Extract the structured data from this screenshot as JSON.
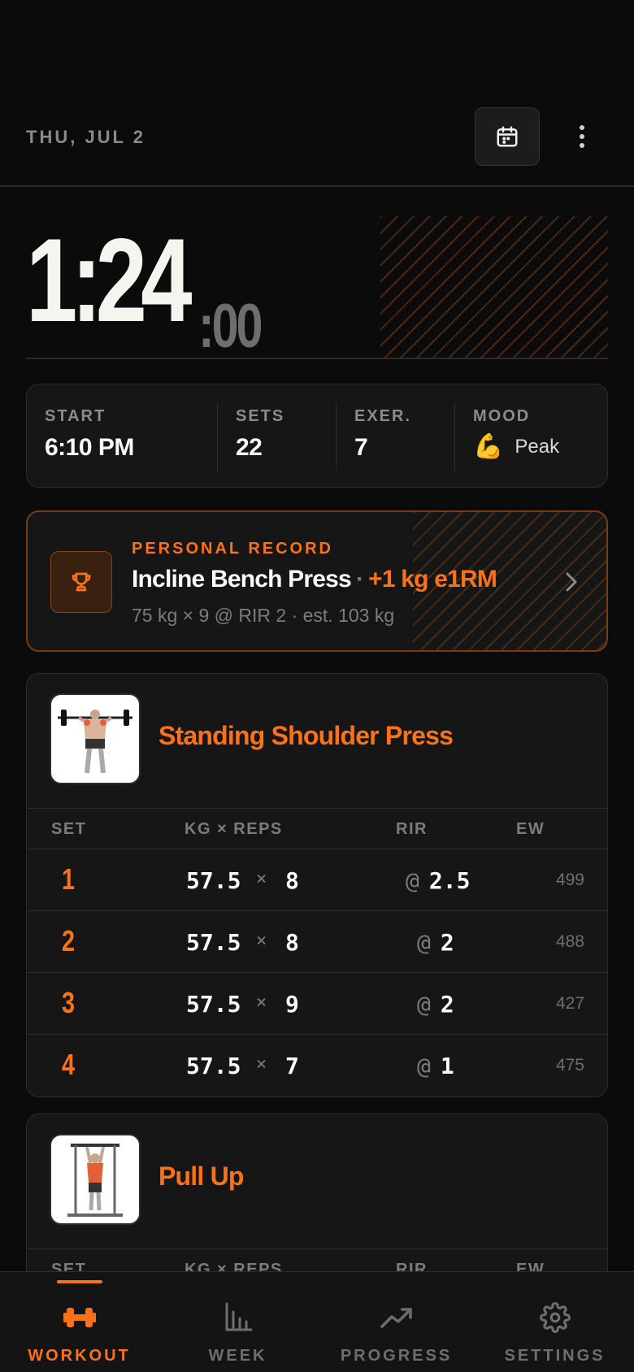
{
  "header": {
    "date": "THU, JUL 2"
  },
  "timer": {
    "main": "1:24",
    "seconds": ":00"
  },
  "stats": [
    {
      "label": "START",
      "value": "6:10 PM"
    },
    {
      "label": "SETS",
      "value": "22"
    },
    {
      "label": "EXER.",
      "value": "7"
    },
    {
      "label": "MOOD",
      "emoji": "💪",
      "value": "Peak"
    }
  ],
  "record": {
    "label": "PERSONAL RECORD",
    "exercise": "Incline Bench Press",
    "separator": "·",
    "gain": "+1 kg e1RM",
    "detail": "75 kg × 9 @ RIR 2  ·  est. 103 kg"
  },
  "table_headers": {
    "set": "SET",
    "kg_reps": "KG × REPS",
    "rir": "RIR",
    "ew": "EW"
  },
  "exercises": [
    {
      "name": "Standing Shoulder Press",
      "sets": [
        {
          "num": "1",
          "kg": "57.5",
          "x": "×",
          "reps": "8",
          "at": "@",
          "rir": "2.5",
          "ew": "499"
        },
        {
          "num": "2",
          "kg": "57.5",
          "x": "×",
          "reps": "8",
          "at": "@",
          "rir": "2",
          "ew": "488"
        },
        {
          "num": "3",
          "kg": "57.5",
          "x": "×",
          "reps": "9",
          "at": "@",
          "rir": "2",
          "ew": "427"
        },
        {
          "num": "4",
          "kg": "57.5",
          "x": "×",
          "reps": "7",
          "at": "@",
          "rir": "1",
          "ew": "475"
        }
      ]
    },
    {
      "name": "Pull Up"
    }
  ],
  "nav": [
    {
      "label": "WORKOUT",
      "icon": "dumbbell-icon"
    },
    {
      "label": "WEEK",
      "icon": "bar-chart-icon"
    },
    {
      "label": "PROGRESS",
      "icon": "trend-up-icon"
    },
    {
      "label": "SETTINGS",
      "icon": "gear-icon"
    }
  ],
  "colors": {
    "accent": "#f97316",
    "background": "#0b0b0b",
    "card": "#161616"
  }
}
